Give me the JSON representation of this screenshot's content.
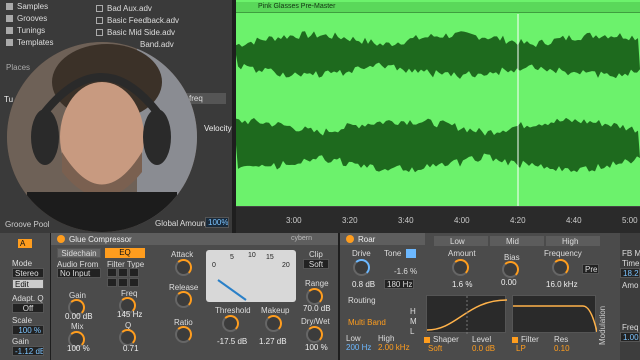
{
  "browser": {
    "categories": [
      "Samples",
      "Grooves",
      "Tunings",
      "Templates"
    ],
    "places_label": "Places",
    "files": [
      "Bad Aux.adv",
      "Basic Feedback.adv",
      "Basic Mid Side.adv",
      "Band.adv"
    ],
    "partial_tu": "Tu",
    "partial_freq": "freq",
    "velocity": "Velocity",
    "groove_pool": "Groove Pool",
    "global_amount_label": "Global Amount",
    "global_amount_value": "100%"
  },
  "arrangement": {
    "clip_name": "Pink Glasses Pre-Master",
    "ruler_ticks": [
      "3:00",
      "3:20",
      "3:40",
      "4:00",
      "4:20",
      "4:40",
      "5:00"
    ],
    "clip_color": "#6cf26c"
  },
  "audio_effect": {
    "a_btn": "A",
    "mode_label": "Mode",
    "mode_value": "Stereo",
    "edit_label": "Edit",
    "adapt_q_label": "Adapt. Q",
    "adapt_q_value": "Off",
    "scale_label": "Scale",
    "scale_value": "100 %",
    "gain_label": "Gain",
    "gain_value": "-1.12 dB"
  },
  "glue": {
    "title": "Glue Compressor",
    "sidechain_label": "Sidechain",
    "eq_label": "EQ",
    "audio_from_label": "Audio From",
    "audio_from_value": "No Input",
    "filter_type_label": "Filter Type",
    "gain_label": "Gain",
    "gain_value": "0.00 dB",
    "mix_label": "Mix",
    "mix_value": "100 %",
    "freq_label": "Freq",
    "freq_value": "145 Hz",
    "q_label": "Q",
    "q_value": "0.71",
    "attack_label": "Attack",
    "release_label": "Release",
    "ratio_label": "Ratio",
    "meter_scale": [
      "0",
      "5",
      "10",
      "15",
      "20"
    ],
    "cybernetic": "cybern",
    "clip_label": "Clip",
    "soft_label": "Soft",
    "range_label": "Range",
    "range_value": "70.0 dB",
    "dry_wet_label": "Dry/Wet",
    "dry_wet_value": "100 %",
    "threshold_label": "Threshold",
    "threshold_value": "-17.5 dB",
    "makeup_label": "Makeup",
    "makeup_value": "1.27 dB"
  },
  "roar": {
    "title": "Roar",
    "drive_label": "Drive",
    "drive_value": "0.8 dB",
    "tone_label": "Tone",
    "tone_value": "-1.6 %",
    "tone_freq": "180 Hz",
    "routing_label": "Routing",
    "routing_value": "Multi Band",
    "low_label": "Low",
    "low_value": "200 Hz",
    "high_label": "High",
    "high_value": "2.00 kHz",
    "h_label": "H",
    "m_label": "M",
    "l_label": "L",
    "band_low": "Low",
    "band_mid": "Mid",
    "band_high": "High",
    "amount_label": "Amount",
    "amount_value": "1.6 %",
    "bias_label": "Bias",
    "bias_value": "0.00",
    "frequency_label": "Frequency",
    "frequency_value": "16.0 kHz",
    "pre_label": "Pre",
    "shaper_label": "Shaper",
    "shaper_value": "Soft",
    "level_label": "Level",
    "level_value": "0.0 dB",
    "filter_label": "Filter",
    "filter_value": "LP",
    "res_label": "Res",
    "res_value": "0.10",
    "modulation_label": "Modulation",
    "fb_label": "FB M",
    "time_label": "Time",
    "time_value": "18.2",
    "amo_label": "Amo",
    "freq_label": "Freq",
    "freq_value": "1.00"
  }
}
